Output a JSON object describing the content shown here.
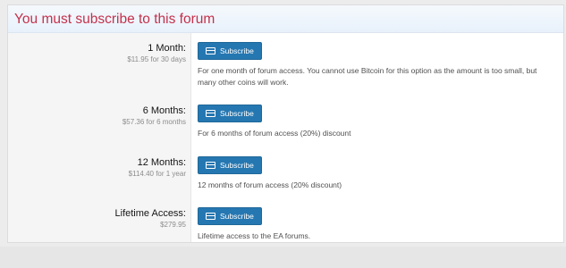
{
  "title": "You must subscribe to this forum",
  "options": [
    {
      "term": "1 Month:",
      "price": "$11.95 for 30 days",
      "button_label": "Subscribe",
      "description": "For one month of forum access. You cannot use Bitcoin for this option as the amount is too small, but many other coins will work."
    },
    {
      "term": "6 Months:",
      "price": "$57.36 for 6 months",
      "button_label": "Subscribe",
      "description": "For 6 months of forum access (20%) discount"
    },
    {
      "term": "12 Months:",
      "price": "$114.40 for 1 year",
      "button_label": "Subscribe",
      "description": "12 months of forum access (20% discount)"
    },
    {
      "term": "Lifetime Access:",
      "price": "$279.95",
      "button_label": "Subscribe",
      "description": "Lifetime access to the EA forums."
    }
  ],
  "colors": {
    "title": "#c4314b",
    "button": "#2577b1"
  },
  "icons": {
    "button_icon": "credit-card-icon"
  }
}
